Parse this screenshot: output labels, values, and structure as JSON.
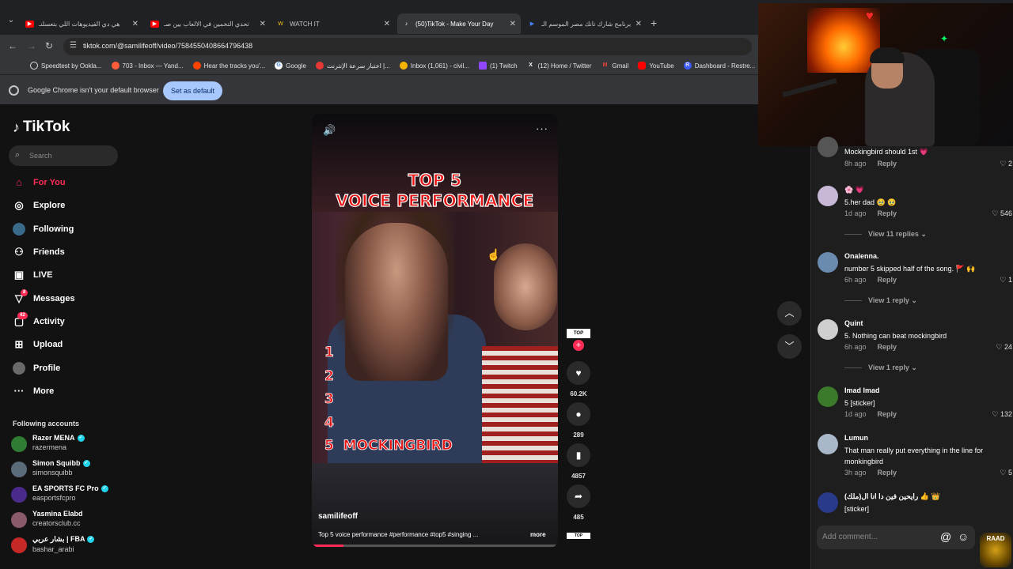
{
  "browser": {
    "tabs": [
      {
        "title": "هي دي الفيديوهات اللي بتعسلنـ",
        "icon": "youtube-icon",
        "color": "#ff0000"
      },
      {
        "title": "تحدي التخمين في الالعاب بين صـ",
        "icon": "youtube-icon",
        "color": "#ff0000"
      },
      {
        "title": "WATCH IT",
        "icon": "watchit-icon",
        "color": "#f5c518"
      },
      {
        "title": "(50)TikTok - Make Your Day",
        "icon": "tiktok-icon",
        "color": "#000000",
        "active": true
      },
      {
        "title": "برنامج شارك تانك مصر الموسم الـ",
        "icon": "play-icon",
        "color": "#4285f4"
      }
    ],
    "url": "tiktok.com/@samilifeoff/video/7584550408664796438",
    "bookmarks": [
      {
        "label": "Speedtest by Ookla...",
        "icon": "speedtest-icon",
        "color": "#e0e0e0"
      },
      {
        "label": "703 - Inbox — Yand...",
        "icon": "yandex-icon",
        "color": "#ff5c39"
      },
      {
        "label": "Hear the tracks you'...",
        "icon": "music-icon",
        "color": "#ff4400"
      },
      {
        "label": "Google",
        "icon": "google-icon",
        "color": "#4285f4"
      },
      {
        "label": "اختبار سرعة الإنترنت |...",
        "icon": "speed-icon",
        "color": "#e53935"
      },
      {
        "label": "Inbox (1,061) - civil...",
        "icon": "mail-icon",
        "color": "#f4b400"
      },
      {
        "label": "(1) Twitch",
        "icon": "twitch-icon",
        "color": "#9146ff"
      },
      {
        "label": "(12) Home / Twitter",
        "icon": "x-icon",
        "color": "#ffffff"
      },
      {
        "label": "Gmail",
        "icon": "gmail-icon",
        "color": "#ea4335"
      },
      {
        "label": "YouTube",
        "icon": "youtube-icon",
        "color": "#ff0000"
      },
      {
        "label": "Dashboard - Restre...",
        "icon": "restream-icon",
        "color": "#3a5bff"
      }
    ],
    "infobar": {
      "message": "Google Chrome isn't your default browser",
      "button": "Set as default"
    }
  },
  "tiktok": {
    "logo": "TikTok",
    "search_placeholder": "Search",
    "nav": [
      {
        "label": "For You",
        "icon": "home-icon",
        "active": true
      },
      {
        "label": "Explore",
        "icon": "compass-icon"
      },
      {
        "label": "Following",
        "icon": "following-icon"
      },
      {
        "label": "Friends",
        "icon": "friends-icon"
      },
      {
        "label": "LIVE",
        "icon": "live-icon"
      },
      {
        "label": "Messages",
        "icon": "messages-icon",
        "badge": "8"
      },
      {
        "label": "Activity",
        "icon": "activity-icon",
        "badge": "42"
      },
      {
        "label": "Upload",
        "icon": "upload-icon"
      },
      {
        "label": "Profile",
        "icon": "profile-icon"
      },
      {
        "label": "More",
        "icon": "more-icon"
      }
    ],
    "following_header": "Following accounts",
    "following": [
      {
        "name": "Razer MENA",
        "handle": "razermena",
        "verified": true,
        "color": "#2e7d32"
      },
      {
        "name": "Simon Squibb",
        "handle": "simonsquibb",
        "verified": true,
        "color": "#5c6b7a"
      },
      {
        "name": "EA SPORTS FC Pro",
        "handle": "easportsfcpro",
        "verified": true,
        "color": "#4a2b8c"
      },
      {
        "name": "Yasmina Elabd",
        "handle": "creatorsclub.cc",
        "verified": false,
        "color": "#8a5a6a"
      },
      {
        "name": "بشار عربي | FBA",
        "handle": "bashar_arabi",
        "verified": true,
        "color": "#c62828"
      }
    ]
  },
  "video": {
    "title_line1": "TOP 5",
    "title_line2": "VOICE PERFORMANCE",
    "ranks": [
      "1",
      "2",
      "3",
      "4",
      "5  MOCKINGBIRD"
    ],
    "author": "samilifeoff",
    "description": "Top 5 voice performance #performance #top5 #singing ...",
    "more": "more",
    "progress": 0.13,
    "avatar_text": "TOP",
    "likes": "60.2K",
    "comments": "289",
    "saves": "4857",
    "shares": "485",
    "music_text": "TOP"
  },
  "comments": [
    {
      "name": "",
      "text": "Mockingbird should 1st 💗",
      "time": "8h ago",
      "likes": "2",
      "color": "#555555"
    },
    {
      "name": "🌸 💗",
      "text": "5.her dad 🥹 🥹",
      "time": "1d ago",
      "likes": "546",
      "replies": "View 11 replies",
      "color": "#c8b8d8"
    },
    {
      "name": "Onalenna.",
      "text": "number 5 skipped half of the song. 🚩 🙌",
      "time": "6h ago",
      "likes": "1",
      "replies": "View 1 reply",
      "color": "#6a8ab0"
    },
    {
      "name": "Quint",
      "text": "5. Nothing can beat mockingbird",
      "time": "6h ago",
      "likes": "24",
      "replies": "View 1 reply",
      "color": "#cfcfcf"
    },
    {
      "name": "Imad Imad",
      "text": "5 [sticker]",
      "time": "1d ago",
      "likes": "132",
      "color": "#3a7a2a"
    },
    {
      "name": "Lumun",
      "text": "That man really put everything in the line for monkingbird",
      "time": "3h ago",
      "likes": "5",
      "color": "#a8b8c8"
    },
    {
      "name": "رايحين فين دا انا ال(ملك) 👍 👑",
      "text": "[sticker]",
      "time": "",
      "likes": "",
      "color": "#2a3a8a"
    }
  ],
  "reply_label": "Reply",
  "add_comment_placeholder": "Add comment...",
  "overlay_badge": "RAAD"
}
